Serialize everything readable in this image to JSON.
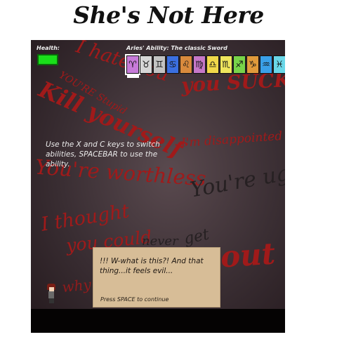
{
  "page_title": "She's Not Here",
  "hud": {
    "health_label": "Health:",
    "health_level": 1.0,
    "health_color": "#1adf1a",
    "ability_label": "Aries' Ability: The classic Sword",
    "selected_index": 0,
    "zodiac": [
      {
        "name": "aries",
        "glyph": "♈",
        "color": "#c77bd9"
      },
      {
        "name": "taurus",
        "glyph": "♉",
        "color": "#d6d6d6"
      },
      {
        "name": "gemini",
        "glyph": "♊",
        "color": "#c3c3c3"
      },
      {
        "name": "cancer",
        "glyph": "♋",
        "color": "#3b6fe0"
      },
      {
        "name": "leo",
        "glyph": "♌",
        "color": "#d98a3d"
      },
      {
        "name": "virgo",
        "glyph": "♍",
        "color": "#c678c8"
      },
      {
        "name": "libra",
        "glyph": "♎",
        "color": "#f0d84a"
      },
      {
        "name": "scorpio",
        "glyph": "♏",
        "color": "#efe65d"
      },
      {
        "name": "sagittarius",
        "glyph": "♐",
        "color": "#78d44a"
      },
      {
        "name": "capricorn",
        "glyph": "♑",
        "color": "#e09a3b"
      },
      {
        "name": "aquarius",
        "glyph": "♒",
        "color": "#3aa0e8"
      },
      {
        "name": "pisces",
        "glyph": "♓",
        "color": "#6ad7e8"
      }
    ]
  },
  "instructions": "Use the X and C keys to switch abilities, SPACEBAR to use the ability.",
  "dialog": {
    "text": "!!! W-what is this?! And that thing...it feels evil...",
    "prompt": "Press SPACE to continue"
  },
  "graffiti": {
    "i_hate_you": "I hate you",
    "you_suck": "you SUCK",
    "youre_stupid": "YOU'RE Stupid",
    "kill_yourself": "Kill yourself",
    "im_disappointed": "I'm disappointed",
    "youre_worthless": "You're worthless",
    "youre_ugly": "You're ugly",
    "i_thought": "I thought",
    "you_could": "you could",
    "never": "never",
    "get": "get",
    "out": "out",
    "why_you_born": "why were you born"
  },
  "colors": {
    "graffiti_red": "#a01a1a",
    "dialog_bg": "#d7bd97",
    "ground": "#050303"
  }
}
